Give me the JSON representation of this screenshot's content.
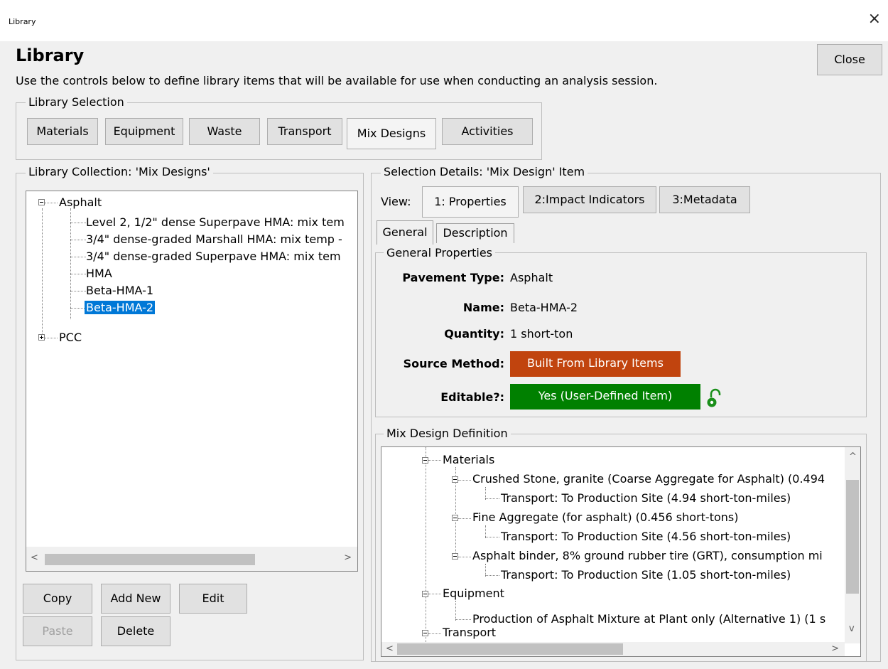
{
  "window": {
    "title": "Library",
    "close_glyph": "×"
  },
  "header": {
    "title": "Library",
    "description": "Use the controls below to define library items that will be available for use when conducting an analysis session.",
    "close_button": "Close"
  },
  "library_selection": {
    "legend": "Library Selection",
    "buttons": [
      "Materials",
      "Equipment",
      "Waste",
      "Transport",
      "Mix Designs",
      "Activities"
    ],
    "selected": "Mix Designs"
  },
  "collection": {
    "legend": "Library Collection: 'Mix Designs'",
    "tree": {
      "root1": "Asphalt",
      "children": [
        "Level 2, 1/2\" dense Superpave HMA: mix tem",
        "3/4\" dense-graded Marshall HMA: mix temp -",
        "3/4\" dense-graded Superpave HMA: mix tem",
        "HMA",
        "Beta-HMA-1",
        "Beta-HMA-2"
      ],
      "selected": "Beta-HMA-2",
      "root2": "PCC"
    },
    "buttons": {
      "copy": "Copy",
      "add_new": "Add New",
      "edit": "Edit",
      "paste": "Paste",
      "delete": "Delete"
    }
  },
  "details": {
    "legend": "Selection Details: 'Mix Design' Item",
    "view_label": "View:",
    "view_buttons": [
      "1: Properties",
      "2:Impact Indicators",
      "3:Metadata"
    ],
    "tabs": [
      "General",
      "Description"
    ],
    "general": {
      "legend": "General Properties",
      "pavement_type_label": "Pavement Type:",
      "pavement_type": "Asphalt",
      "name_label": "Name:",
      "name": "Beta-HMA-2",
      "quantity_label": "Quantity:",
      "quantity": "1 short-ton",
      "source_label": "Source Method:",
      "source": "Built From Library Items",
      "source_color": "#c1440e",
      "editable_label": "Editable?:",
      "editable": "Yes (User-Defined Item)",
      "editable_color": "#008000",
      "lock_icon": "unlock-icon"
    },
    "mix_definition": {
      "legend": "Mix Design Definition",
      "nodes": [
        "Materials",
        "Crushed Stone, granite (Coarse Aggregate for Asphalt) (0.494",
        "Transport: To Production Site (4.94 short-ton-miles)",
        "Fine Aggregate (for asphalt) (0.456 short-tons)",
        "Transport: To Production Site (4.56 short-ton-miles)",
        "Asphalt binder, 8% ground rubber tire (GRT), consumption mi",
        "Transport: To Production Site (1.05 short-ton-miles)",
        "Equipment",
        "Production of Asphalt Mixture at Plant only (Alternative 1) (1 s",
        "Transport"
      ]
    }
  }
}
